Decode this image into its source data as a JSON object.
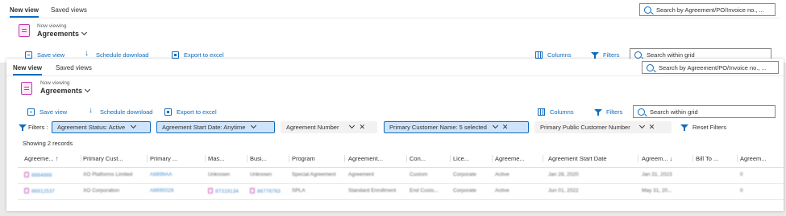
{
  "outer": {
    "tabs": [
      "New view",
      "Saved views"
    ],
    "search_placeholder": "Search by Agreement/PO/Invoice no., ...",
    "now_viewing": "Now viewing",
    "view_title": "Agreements",
    "commands": [
      "Save view",
      "Schedule download",
      "Export to excel"
    ],
    "columns_label": "Columns",
    "filters_label": "Filters",
    "grid_search_placeholder": "Search within grid"
  },
  "inner": {
    "tabs": [
      "New view",
      "Saved views"
    ],
    "search_placeholder": "Search by Agreement/PO/Invoice no., ...",
    "now_viewing": "Now viewing",
    "view_title": "Agreements",
    "commands": [
      "Save view",
      "Schedule download",
      "Export to excel"
    ],
    "columns_label": "Columns",
    "filters_label": "Filters",
    "grid_search_placeholder": "Search within grid"
  },
  "filter_bar": {
    "label": "Filters :",
    "pills": [
      {
        "text": "Agreement Status:  Active",
        "selected": true,
        "close": false
      },
      {
        "text": "Agreement Start Date:  Anytime",
        "selected": true,
        "close": false
      },
      {
        "text": "Agreement Number",
        "selected": false,
        "close": true
      },
      {
        "text": "Primary Customer Name:  5 selected",
        "selected": true,
        "close": true
      },
      {
        "text": "Primary Public Customer Number",
        "selected": false,
        "close": true
      }
    ],
    "reset_label": "Reset Filters"
  },
  "records_text": "Showing 2 records",
  "columns": [
    "Agreeme... ↑",
    "Primary Cust...",
    "Primary ...",
    "Mas...",
    "Busi...",
    "Program",
    "Agreement...",
    "Con...",
    "Lice...",
    "Agreeme...",
    "Agreement Start Date",
    "Agreem... ↓",
    "Bill To ...",
    "Agreem..."
  ],
  "rows": [
    [
      "8884888",
      "XO Platforms Limited",
      "A8899AA",
      "Unknown",
      "Unknown",
      "Special Agreement",
      "Agreement",
      "Custom",
      "Corporate",
      "Active",
      "Jan 28, 2020",
      "Jan 31, 2023",
      "",
      "0"
    ],
    [
      "86912537",
      "XO Corporation",
      "A8690026",
      "87319134",
      "86776763",
      "SPLA",
      "Standard Enrollment",
      "End Custo...",
      "Corporate",
      "Active",
      "Jun 01, 2022",
      "May 31, 20...",
      "",
      "0"
    ]
  ]
}
